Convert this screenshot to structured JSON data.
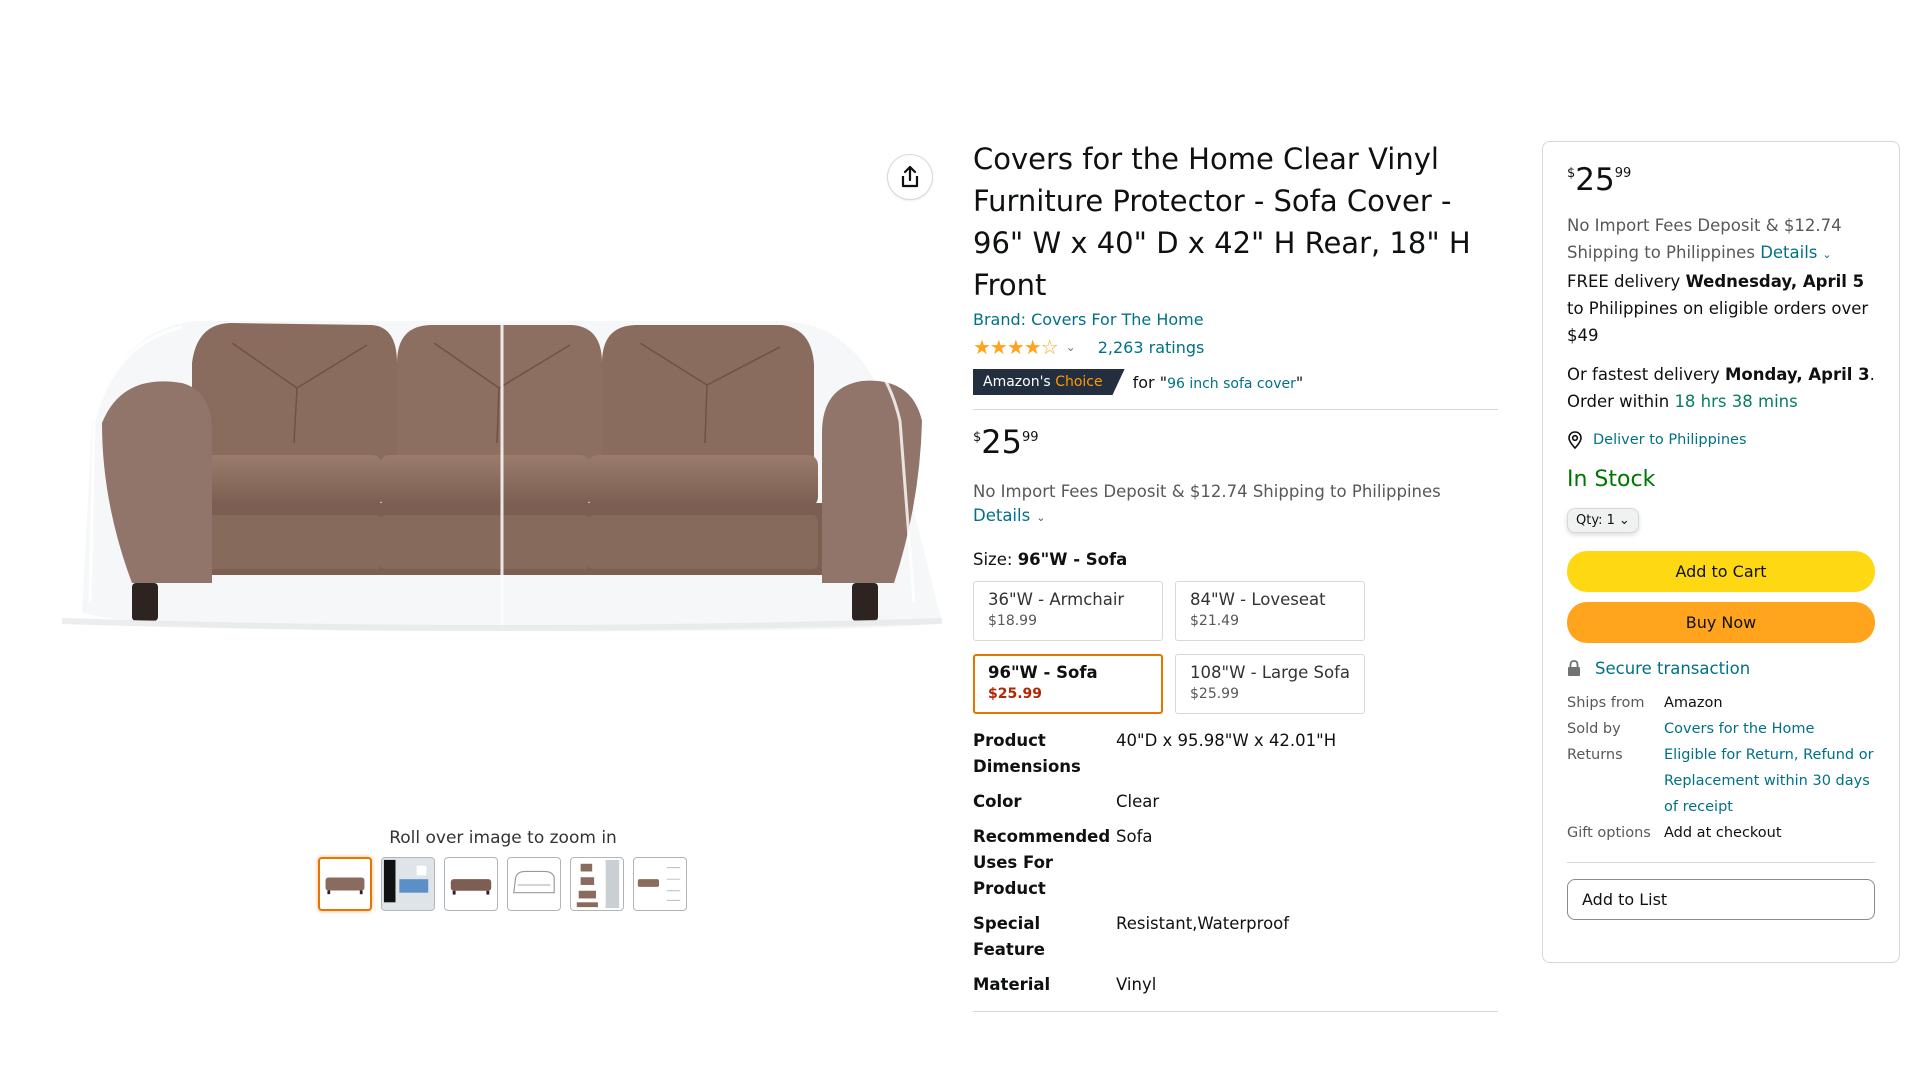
{
  "gallery": {
    "zoom_hint": "Roll over image to zoom in",
    "thumbnail_count": 6,
    "active_thumbnail": 1
  },
  "product": {
    "title": "Covers for the Home Clear Vinyl Furniture Protector - Sofa Cover - 96\" W x 40\" D x 42\" H Rear, 18\" H Front",
    "brand": "Brand: Covers For The Home",
    "stars": "★★★★☆",
    "rating_value": 4.3,
    "ratings_link": "2,263 ratings",
    "badge": {
      "part1": "Amazon's",
      "part2": "Choice"
    },
    "badge_for": "for \"",
    "badge_query": "96 inch sofa cover",
    "badge_close": "\"",
    "price": {
      "symbol": "$",
      "whole": "25",
      "fraction": "99"
    },
    "import_note": "No Import Fees Deposit & $12.74 Shipping to Philippines",
    "details_link": "Details",
    "size_label": "Size:",
    "size_selected": "96\"W - Sofa",
    "sizes": [
      {
        "name": "36\"W - Armchair",
        "price": "$18.99"
      },
      {
        "name": "84\"W - Loveseat",
        "price": "$21.49"
      },
      {
        "name": "96\"W - Sofa",
        "price": "$25.99"
      },
      {
        "name": "108\"W - Large Sofa",
        "price": "$25.99"
      }
    ],
    "specs": [
      {
        "key": "Product Dimensions",
        "value": "40\"D x 95.98\"W x 42.01\"H"
      },
      {
        "key": "Color",
        "value": "Clear"
      },
      {
        "key": "Recommended Uses For Product",
        "value": "Sofa"
      },
      {
        "key": "Special Feature",
        "value": "Resistant,Waterproof"
      },
      {
        "key": "Material",
        "value": "Vinyl"
      }
    ]
  },
  "buybox": {
    "price": {
      "symbol": "$",
      "whole": "25",
      "fraction": "99"
    },
    "import_note": "No Import Fees Deposit & $12.74 Shipping to Philippines",
    "details_link": "Details",
    "free_delivery_prefix": "FREE delivery",
    "free_delivery_date": "Wednesday, April 5",
    "free_delivery_suffix": "to Philippines on eligible orders over $49",
    "fastest_prefix": "Or fastest delivery",
    "fastest_date": "Monday, April 3",
    "order_within": "Order within",
    "countdown": "18 hrs 38 mins",
    "deliver_to": "Deliver to Philippines",
    "stock": "In Stock",
    "qty_label": "Qty: 1",
    "add_to_cart": "Add to Cart",
    "buy_now": "Buy Now",
    "secure": "Secure transaction",
    "ships_from_label": "Ships from",
    "ships_from": "Amazon",
    "sold_by_label": "Sold by",
    "sold_by": "Covers for the Home",
    "returns_label": "Returns",
    "returns": "Eligible for Return, Refund or Replacement within 30 days of receipt",
    "gift_label": "Gift options",
    "gift": "Add at checkout",
    "add_to_list": "Add to List"
  },
  "colors": {
    "link": "#007185",
    "cart": "#FFD814",
    "buy": "#FFA41C",
    "instock": "#007600",
    "selected_border": "#E77600",
    "sale_price": "#B12704"
  }
}
